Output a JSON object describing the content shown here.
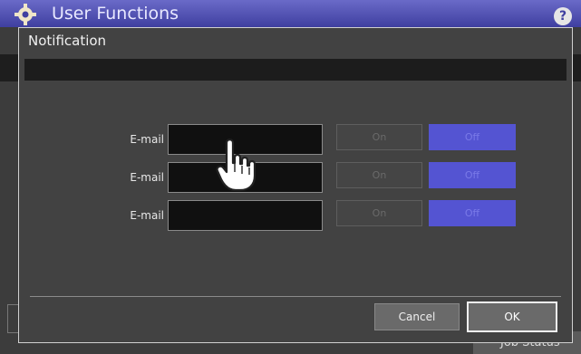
{
  "background": {
    "title": "User Functions",
    "help_label": "?",
    "job_status_label": "Job Status"
  },
  "dialog": {
    "title": "Notification",
    "rows": [
      {
        "label": "E-mail",
        "value": "",
        "on_label": "On",
        "off_label": "Off"
      },
      {
        "label": "E-mail",
        "value": "",
        "on_label": "On",
        "off_label": "Off"
      },
      {
        "label": "E-mail",
        "value": "",
        "on_label": "On",
        "off_label": "Off"
      }
    ],
    "cancel_label": "Cancel",
    "ok_label": "OK"
  },
  "colors": {
    "accent": "#5454d2",
    "header": "#4a4ab0",
    "dialog_bg": "#424242"
  },
  "icons": [
    "gear-icon",
    "help-icon",
    "hand-cursor-icon"
  ]
}
